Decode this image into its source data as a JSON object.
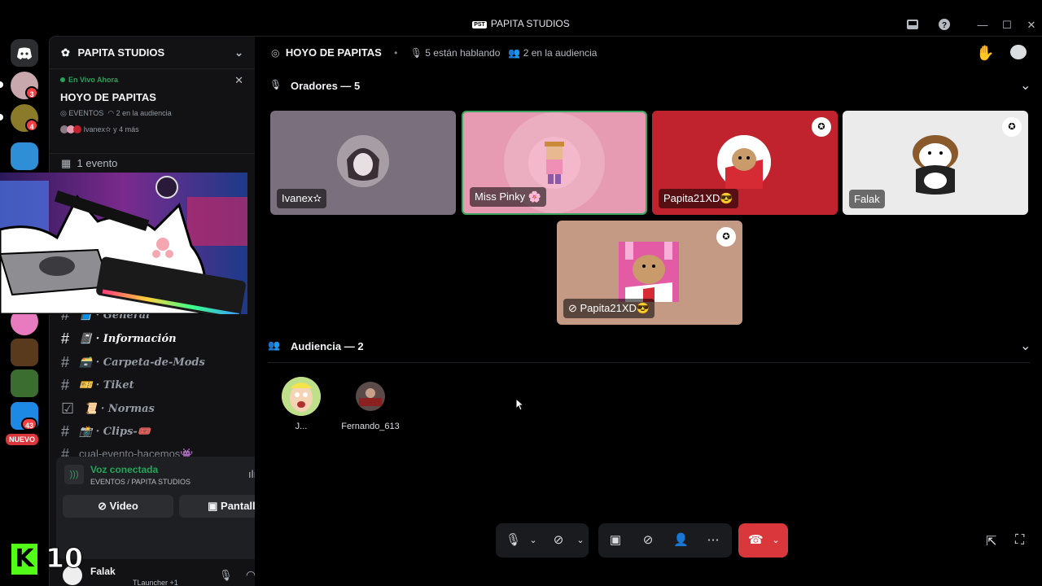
{
  "window": {
    "logo_text": "PST",
    "title": "PAPITA STUDIOS"
  },
  "rail": {
    "badges": [
      "3",
      "4",
      "43"
    ],
    "new_label": "NUEVO"
  },
  "sidebar": {
    "server_name": "PAPITA STUDIOS",
    "live": {
      "status": "En Vivo Ahora",
      "stage_name": "HOYO DE PAPITAS",
      "category": "EVENTOS",
      "audience": "2 en la audiencia",
      "speakers": "Ivanex✫ y 4 más"
    },
    "events_label": "1 evento",
    "channels": [
      {
        "emoji": "📘",
        "name": "· General"
      },
      {
        "emoji": "📓",
        "name": "· Información"
      },
      {
        "emoji": "🗃️",
        "name": "· Carpeta-de-Mods"
      },
      {
        "emoji": "🎫",
        "name": "· Tiket"
      },
      {
        "emoji": "📜",
        "name": "· Normas"
      },
      {
        "emoji": "📸",
        "name": "· Clips-🎟️"
      },
      {
        "emoji": "",
        "name": "cual-evento-hacemos👾"
      }
    ]
  },
  "voice_panel": {
    "status": "Voz conectada",
    "location": "EVENTOS / PAPITA STUDIOS",
    "video_label": "Video",
    "screen_label": "Pantalla"
  },
  "user": {
    "name": "Falak",
    "activity": "TLauncher +1"
  },
  "overlay": {
    "number": "10",
    "logo_letter": "K"
  },
  "stage": {
    "title": "HOYO DE PAPITAS",
    "speaking": "5 están hablando",
    "audience": "2 en la audiencia",
    "speakers_header": "Oradores — 5",
    "audience_header": "Audiencia — 2",
    "speakers": [
      {
        "name": "Ivanex✫",
        "bg": "#7a6f7c"
      },
      {
        "name": "Miss Pinky 🌸",
        "bg": "#e79bb3"
      },
      {
        "name": "Papita21XD😎",
        "bg": "#c0232e"
      },
      {
        "name": "Falak",
        "bg": "#ebebeb"
      },
      {
        "name": "Papita21XD😎",
        "bg": "#c49a84"
      }
    ],
    "audience_members": [
      {
        "name": "J..."
      },
      {
        "name": "Fernando_613"
      }
    ]
  },
  "colors": {
    "accent_green": "#23a55a",
    "speaking_border": "#3ba55d",
    "danger": "#da373c"
  }
}
